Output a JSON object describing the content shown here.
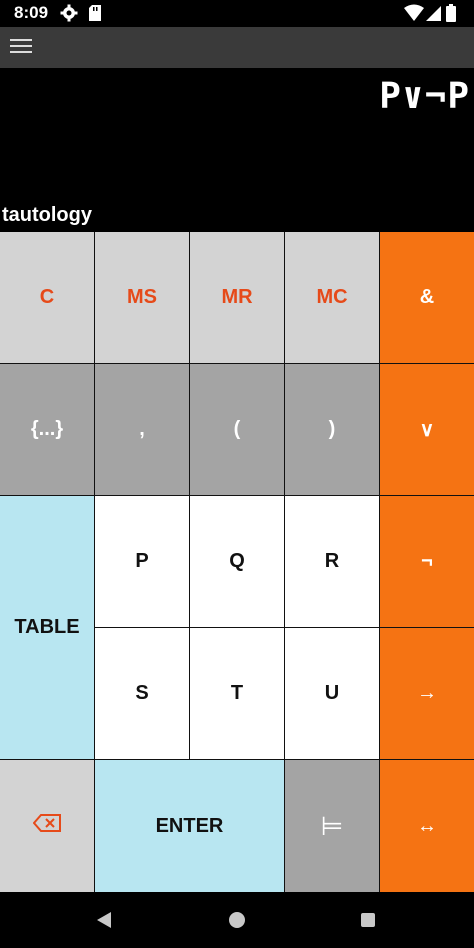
{
  "status_bar": {
    "time": "8:09",
    "icons": [
      "gear-icon",
      "sd-card-icon",
      "wifi-icon",
      "signal-icon",
      "battery-icon"
    ]
  },
  "app_bar": {
    "menu_icon": "hamburger-menu-icon"
  },
  "display": {
    "expression": "P∨¬P",
    "result": "tautology"
  },
  "keys": {
    "c": "C",
    "ms": "MS",
    "mr": "MR",
    "mc": "MC",
    "and": "&",
    "set": "{...}",
    "comma": ",",
    "lparen": "(",
    "rparen": ")",
    "or": "∨",
    "p": "P",
    "q": "Q",
    "r": "R",
    "not": "¬",
    "table": "TABLE",
    "s": "S",
    "t": "T",
    "u": "U",
    "implies": "→",
    "backspace_icon": "backspace-icon",
    "enter": "ENTER",
    "entails": "⊨",
    "iff": "↔"
  },
  "colors": {
    "accent_orange": "#f57313",
    "key_light_gray": "#d3d3d3",
    "key_gray": "#a4a4a4",
    "key_cyan": "#b8e6f1",
    "memory_text": "#e64a19"
  },
  "nav_bar": {
    "icons": [
      "back-icon",
      "home-icon",
      "recents-icon"
    ]
  }
}
